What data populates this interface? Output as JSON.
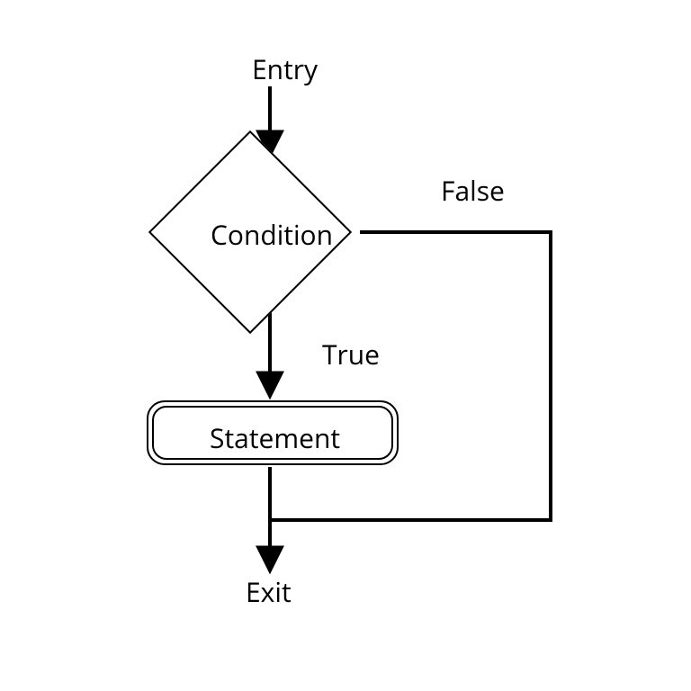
{
  "diagram": {
    "entry": "Entry",
    "condition": "Condition",
    "branch_true": "True",
    "branch_false": "False",
    "statement": "Statement",
    "exit": "Exit"
  }
}
